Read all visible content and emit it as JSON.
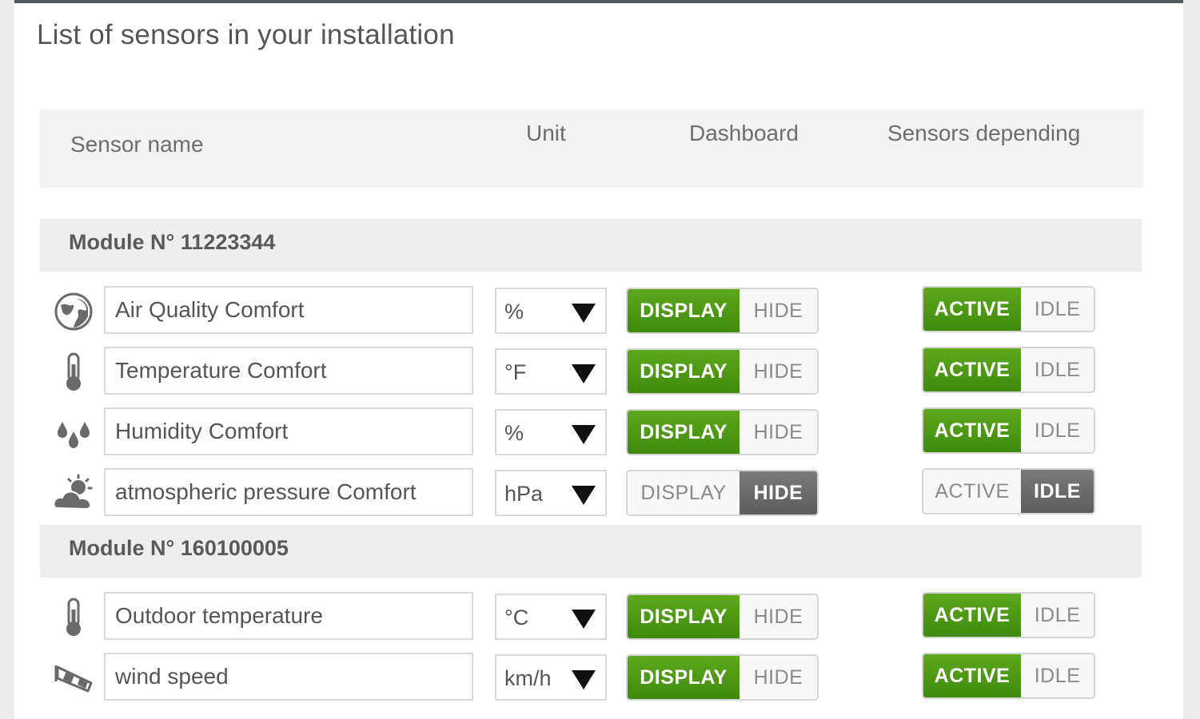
{
  "title": "List of sensors in your installation",
  "headers": {
    "name": "Sensor name",
    "unit": "Unit",
    "dashboard": "Dashboard",
    "depending": "Sensors depending"
  },
  "toggle_labels": {
    "display": "DISPLAY",
    "hide": "HIDE",
    "active": "ACTIVE",
    "idle": "IDLE"
  },
  "colors": {
    "active_green": "#4a961a",
    "selected_gray": "#666666",
    "header_bar": "#555a5e"
  },
  "modules": [
    {
      "label": "Module N° 11223344",
      "sensors": [
        {
          "icon": "globe-icon",
          "name": "Air Quality Comfort",
          "unit": "%",
          "dashboard": "DISPLAY",
          "state": "ACTIVE"
        },
        {
          "icon": "thermometer-icon",
          "name": "Temperature Comfort",
          "unit": "°F",
          "dashboard": "DISPLAY",
          "state": "ACTIVE"
        },
        {
          "icon": "water-drops-icon",
          "name": "Humidity Comfort",
          "unit": "%",
          "dashboard": "DISPLAY",
          "state": "ACTIVE"
        },
        {
          "icon": "cloud-sun-icon",
          "name": "atmospheric pressure Comfort",
          "unit": "hPa",
          "dashboard": "HIDE",
          "state": "IDLE"
        }
      ]
    },
    {
      "label": "Module N° 160100005",
      "sensors": [
        {
          "icon": "thermometer-icon",
          "name": "Outdoor temperature",
          "unit": "°C",
          "dashboard": "DISPLAY",
          "state": "ACTIVE"
        },
        {
          "icon": "windsock-icon",
          "name": "wind speed",
          "unit": "km/h",
          "dashboard": "DISPLAY",
          "state": "ACTIVE"
        }
      ]
    }
  ]
}
